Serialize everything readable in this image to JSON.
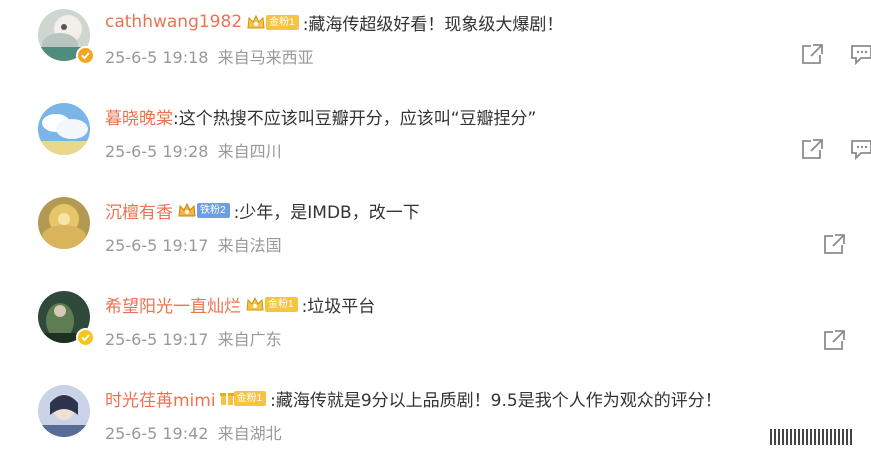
{
  "comments": [
    {
      "username": "cathhwang1982",
      "badge": "金粉1",
      "badge_kind": "gold",
      "text": ":藏海传超级好看！现象级大爆剧！",
      "time": "25-6-5 19:18",
      "location": "来自马来西亚",
      "has_verified": true,
      "has_reply_icon": true
    },
    {
      "username": "暮晓晚棠",
      "badge": "",
      "badge_kind": "",
      "text": ":这个热搜不应该叫豆瓣开分，应该叫“豆瓣捏分”",
      "time": "25-6-5 19:28",
      "location": "来自四川",
      "has_verified": false,
      "has_reply_icon": true
    },
    {
      "username": "沉檀有香",
      "badge": "铁粉2",
      "badge_kind": "iron",
      "text": ":少年，是IMDB，改一下",
      "time": "25-6-5 19:17",
      "location": "来自法国",
      "has_verified": false,
      "has_reply_icon": false
    },
    {
      "username": "希望阳光一直灿烂",
      "badge": "金粉1",
      "badge_kind": "gold",
      "text": ":垃圾平台",
      "time": "25-6-5 19:17",
      "location": "来自广东",
      "has_verified": true,
      "has_reply_icon": false
    },
    {
      "username": "时光荏苒mimi",
      "badge": "金粉1",
      "badge_kind": "gold",
      "text": ":藏海传就是9分以上品质剧！9.5是我个人作为观众的评分！",
      "time": "25-6-5 19:42",
      "location": "来自湖北",
      "has_verified": false,
      "has_reply_icon": false
    }
  ],
  "colors": {
    "username": "#eb7350",
    "meta": "#999999",
    "gold_badge": "#f6c443",
    "iron_badge": "#6f9de3",
    "verified": "#f4a51c"
  },
  "icons": {
    "share": "share-icon",
    "reply": "comment-icon",
    "verified": "verified-icon"
  }
}
